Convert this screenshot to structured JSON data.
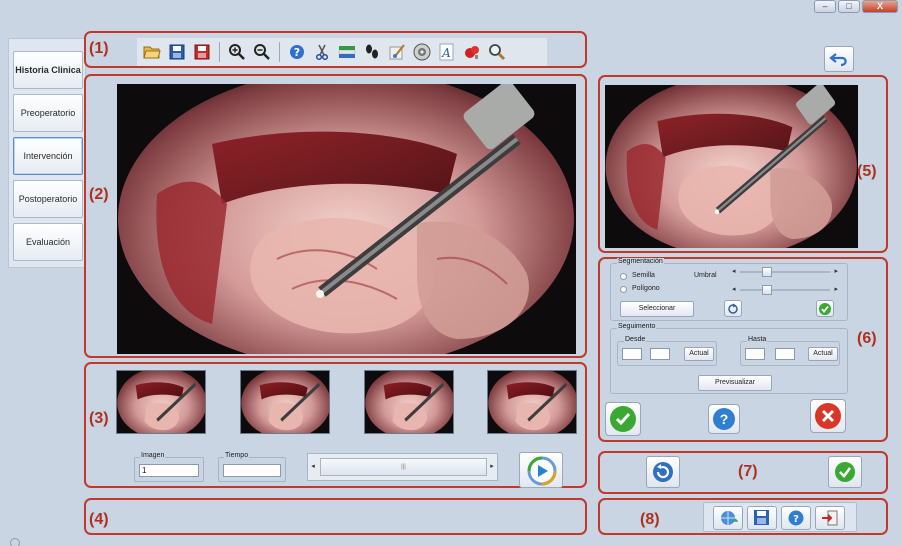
{
  "window": {
    "minimize": "–",
    "maximize": "□",
    "close": "X"
  },
  "regions": {
    "r1": "(1)",
    "r2": "(2)",
    "r3": "(3)",
    "r4": "(4)",
    "r5": "(5)",
    "r6": "(6)",
    "r7": "(7)",
    "r8": "(8)"
  },
  "nav": {
    "items": [
      "Historia Clinica",
      "Preoperatorio",
      "Intervención",
      "Postoperatorio",
      "Evaluación"
    ]
  },
  "toolbar": {
    "icons": [
      "open-folder",
      "save",
      "save-as",
      "zoom-in",
      "zoom-out",
      "help",
      "cut",
      "adjust",
      "footprints",
      "brush",
      "disc",
      "text",
      "marker",
      "magnifier"
    ]
  },
  "playback": {
    "image_legend": "Imagen",
    "image_value": "1",
    "time_legend": "Tiempo",
    "time_value": "",
    "scroll_thumb": "|||"
  },
  "segmentation": {
    "title": "Segmentación",
    "seed_label": "Semilla",
    "polygon_label": "Polígono",
    "threshold_label": "Umbral",
    "select_button": "Seleccionar"
  },
  "tracking": {
    "title": "Seguimento",
    "from_label": "Desde",
    "to_label": "Hasta",
    "from_button": "Actual",
    "to_button": "Actual",
    "preview_button": "Previsualizar"
  },
  "colors": {
    "annotation": "#c0392b",
    "background": "#c9d5e3",
    "ok": "#3aa832",
    "cancel": "#d9362a",
    "help": "#2f7fd0"
  }
}
